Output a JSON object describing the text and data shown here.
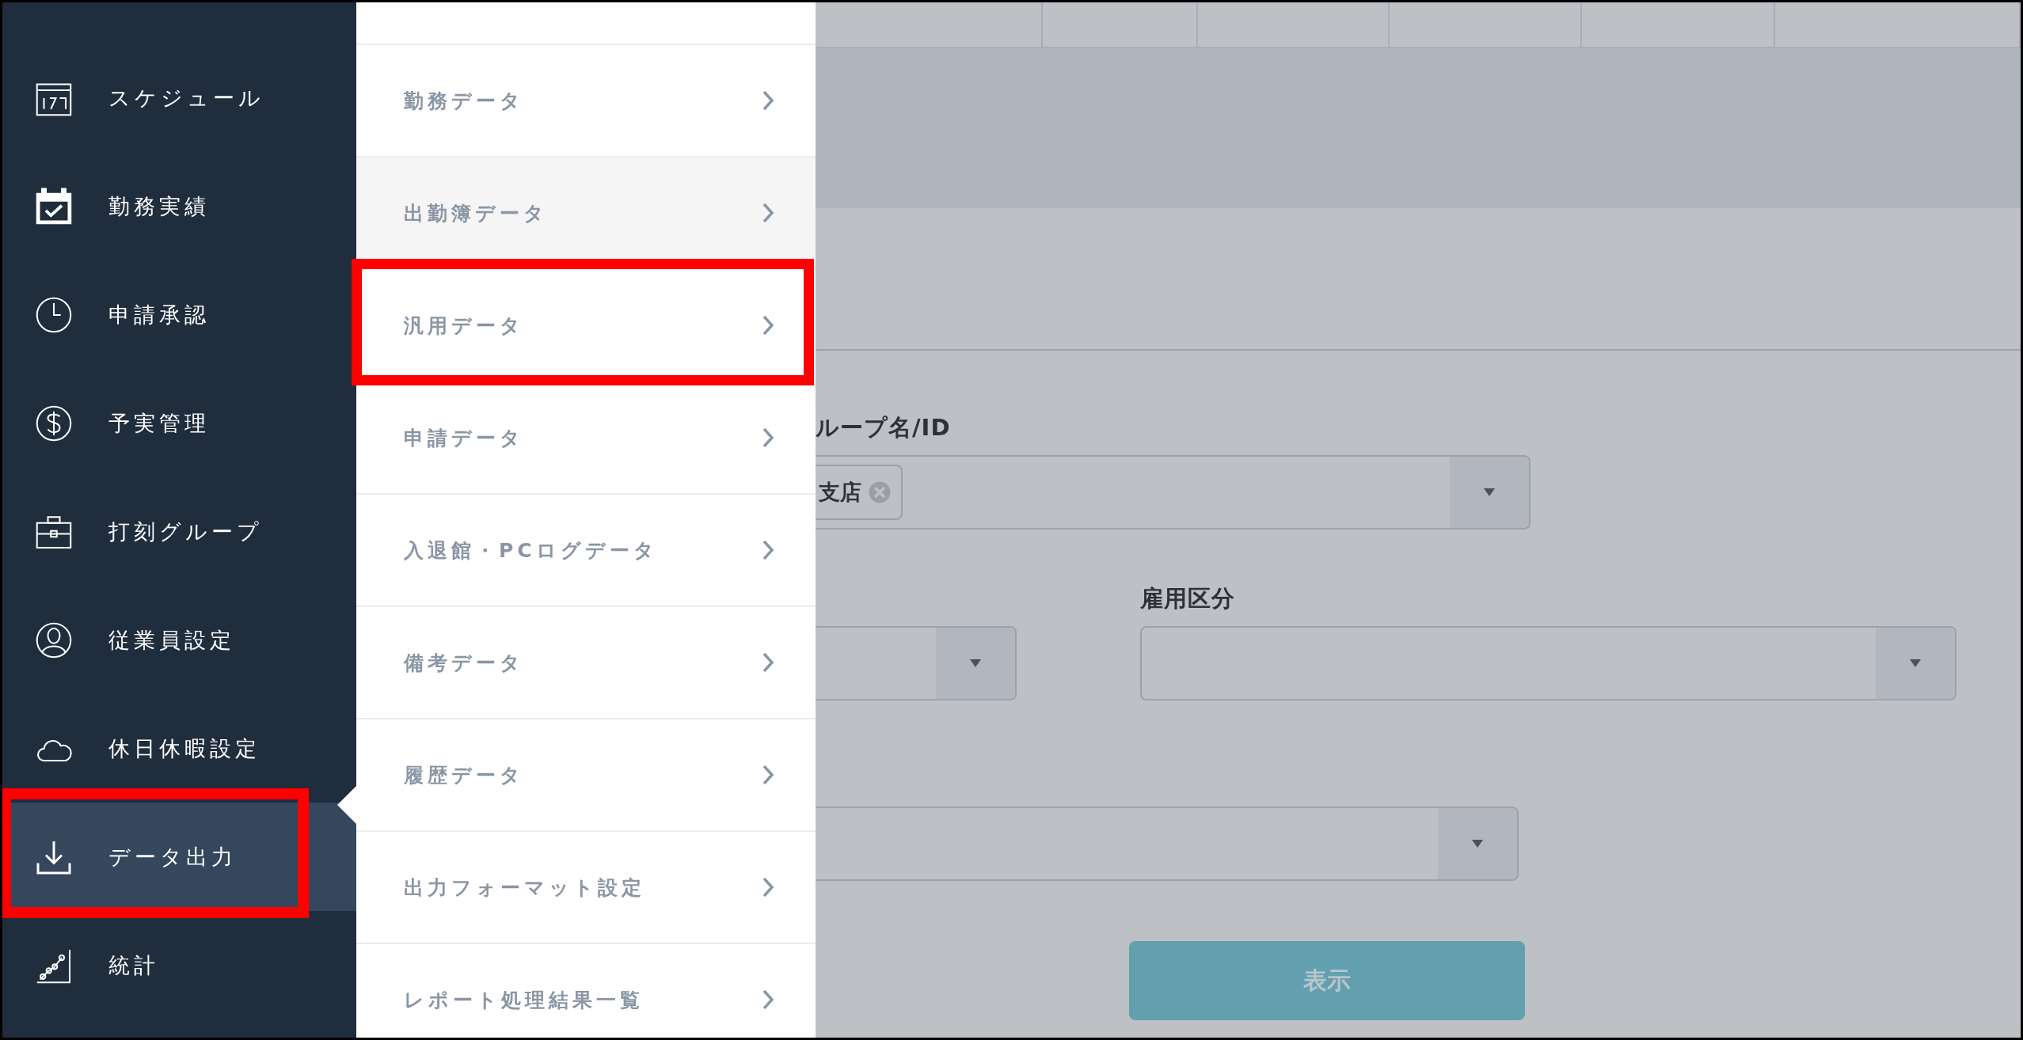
{
  "sidebar": {
    "items": [
      {
        "label": "スケジュール",
        "kind": "calendar",
        "selected": false,
        "highlighted": false
      },
      {
        "label": "勤務実績",
        "kind": "calendar-check",
        "selected": false,
        "highlighted": false
      },
      {
        "label": "申請承認",
        "kind": "clock",
        "selected": false,
        "highlighted": false
      },
      {
        "label": "予実管理",
        "kind": "dollar",
        "selected": false,
        "highlighted": false
      },
      {
        "label": "打刻グループ",
        "kind": "briefcase",
        "selected": false,
        "highlighted": false
      },
      {
        "label": "従業員設定",
        "kind": "person",
        "selected": false,
        "highlighted": false
      },
      {
        "label": "休日休暇設定",
        "kind": "cloud",
        "selected": false,
        "highlighted": false
      },
      {
        "label": "データ出力",
        "kind": "download",
        "selected": true,
        "highlighted": true
      },
      {
        "label": "統計",
        "kind": "chart",
        "selected": false,
        "highlighted": false
      }
    ]
  },
  "submenu": {
    "items": [
      {
        "label": "勤務データ",
        "hovered": false,
        "highlighted": false
      },
      {
        "label": "出勤簿データ",
        "hovered": true,
        "highlighted": false
      },
      {
        "label": "汎用データ",
        "hovered": false,
        "highlighted": true
      },
      {
        "label": "申請データ",
        "hovered": false,
        "highlighted": false
      },
      {
        "label": "入退館・PCログデータ",
        "hovered": false,
        "highlighted": false
      },
      {
        "label": "備考データ",
        "hovered": false,
        "highlighted": false
      },
      {
        "label": "履歴データ",
        "hovered": false,
        "highlighted": false
      },
      {
        "label": "出力フォーマット設定",
        "hovered": false,
        "highlighted": false
      },
      {
        "label": "レポート処理結果一覧",
        "hovered": false,
        "highlighted": false
      }
    ]
  },
  "content": {
    "group_field": {
      "label": "ループ名/ID",
      "chips": [
        "支店"
      ]
    },
    "employment_field": {
      "label": "雇用区分"
    },
    "display_button": "表示"
  }
}
